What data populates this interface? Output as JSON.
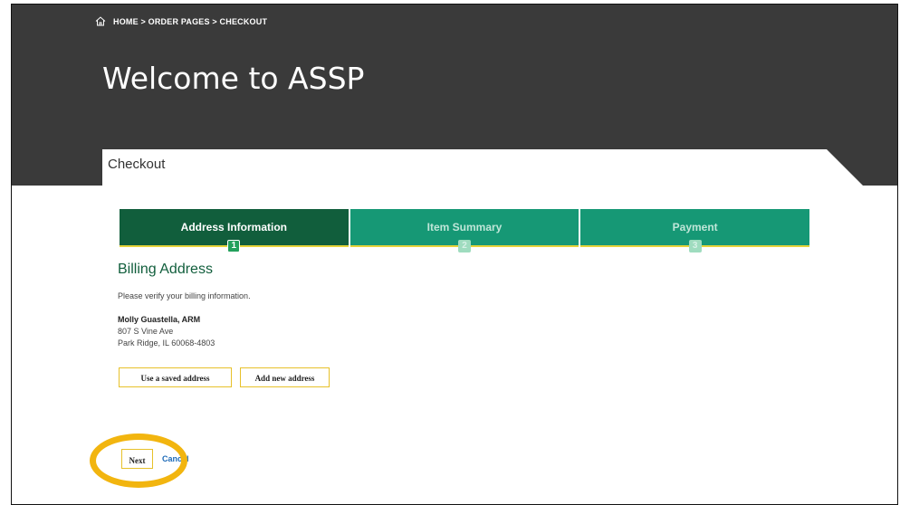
{
  "breadcrumb": {
    "icon": "home-icon",
    "text": "HOME > ORDER PAGES > CHECKOUT"
  },
  "hero": {
    "title": "Welcome to ASSP",
    "background": "#3a3a3a"
  },
  "panel": {
    "label": "Checkout"
  },
  "steps": [
    {
      "label": "Address Information",
      "number": "1",
      "active": true
    },
    {
      "label": "Item Summary",
      "number": "2",
      "active": false
    },
    {
      "label": "Payment",
      "number": "3",
      "active": false
    }
  ],
  "billing": {
    "title": "Billing Address",
    "instruction": "Please verify your billing information.",
    "name": "Molly Guastella, ARM",
    "street": "807 S Vine Ave",
    "city_line": "Park Ridge, IL 60068-4803"
  },
  "buttons": {
    "saved_address": "Use a saved address",
    "new_address": "Add new address",
    "next": "Next",
    "cancel": "Cancel"
  },
  "colors": {
    "active_step": "#115e3c",
    "step": "#169875",
    "accent": "#e7c12a",
    "highlight": "#f2b50f",
    "link": "#1e6bb8"
  }
}
